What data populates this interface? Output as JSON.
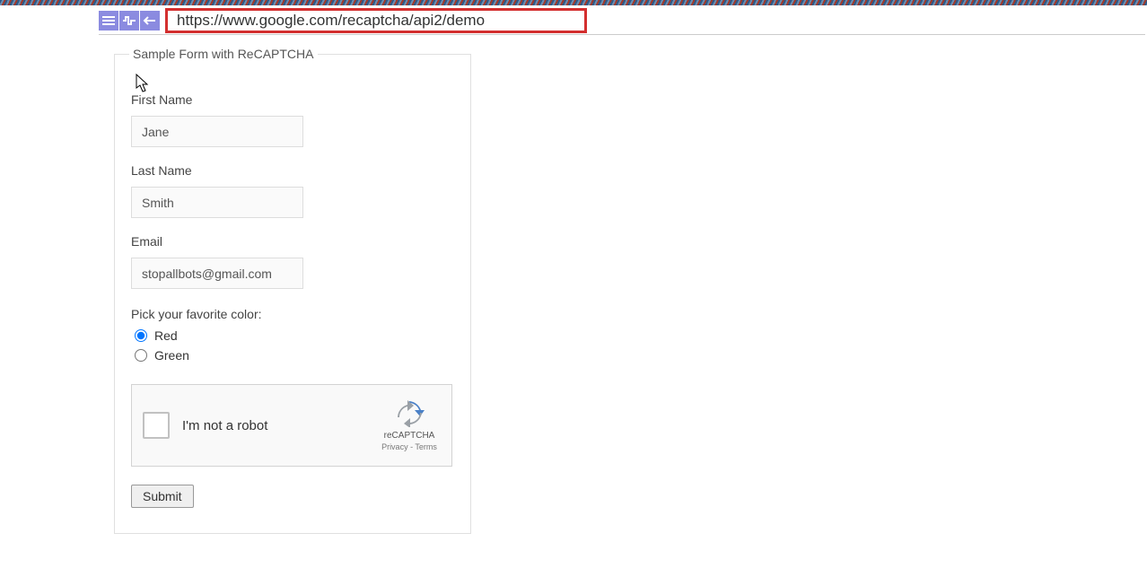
{
  "toolbar": {
    "url": "https://www.google.com/recaptcha/api2/demo"
  },
  "form": {
    "legend": "Sample Form with ReCAPTCHA",
    "first_name_label": "First Name",
    "first_name_value": "Jane",
    "last_name_label": "Last Name",
    "last_name_value": "Smith",
    "email_label": "Email",
    "email_value": "stopallbots@gmail.com",
    "color_prompt": "Pick your favorite color:",
    "color_options": {
      "red": "Red",
      "green": "Green"
    },
    "submit_label": "Submit"
  },
  "recaptcha": {
    "label": "I'm not a robot",
    "brand": "reCAPTCHA",
    "privacy": "Privacy",
    "terms": "Terms",
    "separator": " - "
  }
}
